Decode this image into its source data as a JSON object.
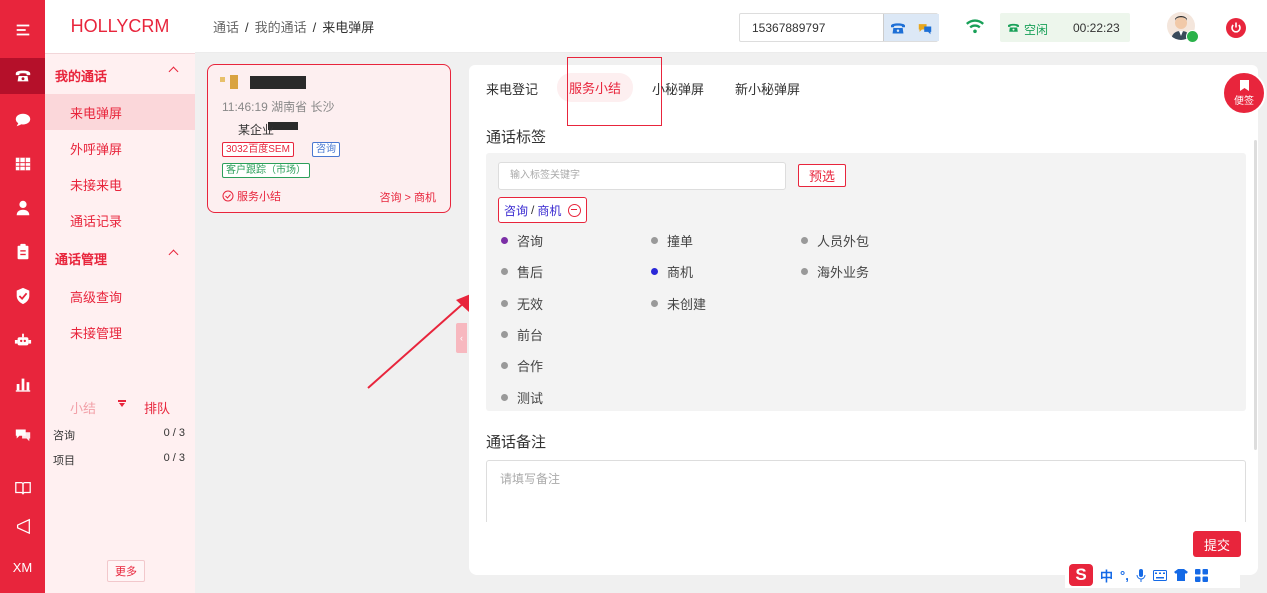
{
  "app": {
    "logo": "HOLLYCRM"
  },
  "rail": {
    "icons": [
      "menu-icon",
      "phone-icon",
      "chat-icon",
      "grid-icon",
      "user-icon",
      "clipboard-icon",
      "shield-icon",
      "robot-icon",
      "bar-chart-icon",
      "message-icon",
      "book-icon",
      "megaphone-icon"
    ],
    "footer_label": "XM"
  },
  "sidebar": {
    "group1": "我的通话",
    "group1_items": [
      "来电弹屏",
      "外呼弹屏",
      "未接来电",
      "通话记录"
    ],
    "group2": "通话管理",
    "group2_items": [
      "高级查询",
      "未接管理"
    ],
    "queue": {
      "tab_summary": "小结",
      "tab_queue": "排队",
      "rows": [
        {
          "label": "咨询",
          "count": "0 / 3"
        },
        {
          "label": "项目",
          "count": "0 / 3"
        }
      ]
    },
    "more": "更多"
  },
  "header": {
    "breadcrumb": [
      "通话",
      "我的通话",
      "来电弹屏"
    ],
    "phone": "15367889797",
    "status": "空闲",
    "timer": "00:22:23"
  },
  "call_card": {
    "time_location": "11:46:19 湖南省 长沙",
    "org": "某企业",
    "source_tag": "3032百度SEM",
    "type_tag": "咨询",
    "follow_tag": "客户跟踪（市场）",
    "status": "服务小结",
    "path": "咨询 > 商机"
  },
  "tabs": [
    "来电登记",
    "服务小结",
    "小秘弹屏",
    "新小秘弹屏"
  ],
  "active_tab": 1,
  "call_tags": {
    "title": "通话标签",
    "search_placeholder": "输入标签关键字",
    "preselect": "预选",
    "selected": {
      "parent": "咨询",
      "sep": " / ",
      "child": "商机"
    },
    "options": [
      {
        "label": "咨询",
        "color": "#7b2fa6"
      },
      {
        "label": "撞单",
        "color": "#999999"
      },
      {
        "label": "人员外包",
        "color": "#999999"
      },
      {
        "label": "售后",
        "color": "#999999"
      },
      {
        "label": "商机",
        "color": "#2a28d8"
      },
      {
        "label": "海外业务",
        "color": "#999999"
      },
      {
        "label": "无效",
        "color": "#999999"
      },
      {
        "label": "未创建",
        "color": "#999999"
      },
      {
        "label": "前台",
        "color": "#999999"
      },
      {
        "label": "合作",
        "color": "#999999"
      },
      {
        "label": "测试",
        "color": "#999999"
      }
    ]
  },
  "remark": {
    "title": "通话备注",
    "placeholder": "请填写备注"
  },
  "submit": "提交",
  "note_button": "便签",
  "ime": {
    "mode": "中"
  },
  "colors": {
    "brand": "#e8253c",
    "active_nav": "#fbd7da",
    "idle_green": "#18a058"
  }
}
